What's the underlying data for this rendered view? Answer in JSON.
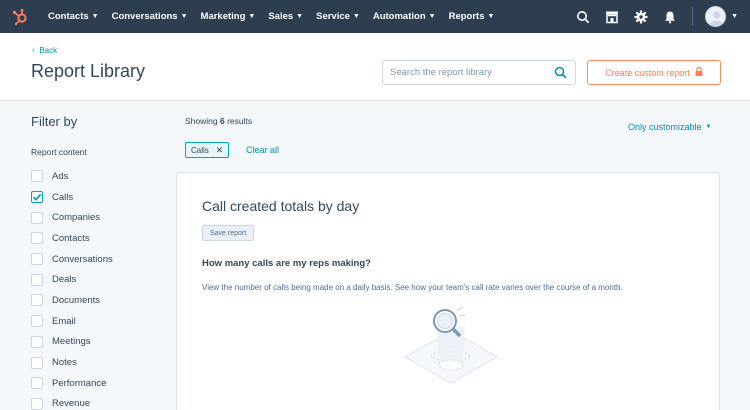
{
  "nav": {
    "items": [
      {
        "label": "Contacts"
      },
      {
        "label": "Conversations"
      },
      {
        "label": "Marketing"
      },
      {
        "label": "Sales"
      },
      {
        "label": "Service"
      },
      {
        "label": "Automation"
      },
      {
        "label": "Reports"
      }
    ],
    "icons": [
      "search-icon",
      "marketplace-icon",
      "gear-icon",
      "bell-icon",
      "avatar"
    ]
  },
  "header": {
    "back_label": "Back",
    "title": "Report Library",
    "search_placeholder": "Search the report library",
    "create_label": "Create custom report"
  },
  "sidebar": {
    "title": "Filter by",
    "subtitle": "Report content",
    "items": [
      {
        "label": "Ads",
        "checked": false
      },
      {
        "label": "Calls",
        "checked": true
      },
      {
        "label": "Companies",
        "checked": false
      },
      {
        "label": "Contacts",
        "checked": false
      },
      {
        "label": "Conversations",
        "checked": false
      },
      {
        "label": "Deals",
        "checked": false
      },
      {
        "label": "Documents",
        "checked": false
      },
      {
        "label": "Email",
        "checked": false
      },
      {
        "label": "Meetings",
        "checked": false
      },
      {
        "label": "Notes",
        "checked": false
      },
      {
        "label": "Performance",
        "checked": false
      },
      {
        "label": "Revenue",
        "checked": false
      }
    ]
  },
  "main": {
    "showing_prefix": "Showing",
    "showing_count": "6",
    "showing_suffix": "results",
    "filter_dropdown": "Only customizable",
    "chip_label": "Calls",
    "clear_label": "Clear all",
    "card": {
      "title": "Call created totals by day",
      "save_label": "Save report",
      "question": "How many calls are my reps making?",
      "description": "View the number of calls being made on a daily basis. See how your team's call rate varies over the course of a month."
    }
  },
  "colors": {
    "nav_bg": "#2d3e50",
    "accent_link": "#0091ae",
    "accent_orange": "#ff7a59",
    "checkbox_on": "#00a4bd"
  }
}
